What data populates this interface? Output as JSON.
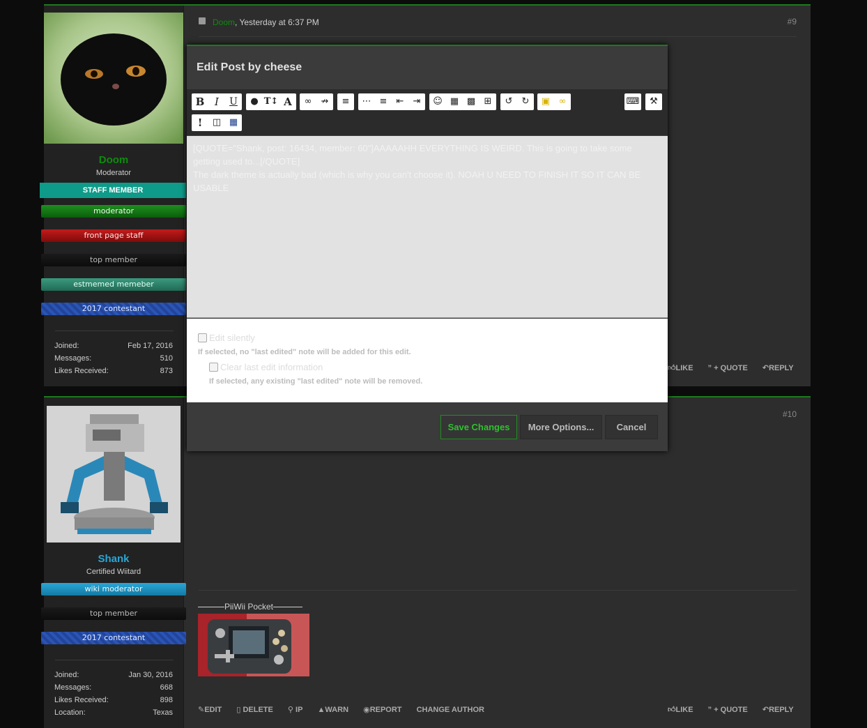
{
  "post1": {
    "number": "#9",
    "author": "Doom",
    "time": ", Yesterday at 6:37 PM",
    "username": "Doom",
    "user_title": "Moderator",
    "banners": [
      "STAFF MEMBER",
      "moderator",
      "front page staff",
      "top member",
      "estmemed memeber",
      "2017 contestant"
    ],
    "stats": [
      {
        "k": "Joined:",
        "v": "Feb 17, 2016"
      },
      {
        "k": "Messages:",
        "v": "510"
      },
      {
        "k": "Likes Received:",
        "v": "873"
      }
    ],
    "actions": [
      "LIKE",
      "+ QUOTE",
      "REPLY"
    ]
  },
  "post2": {
    "number": "#10",
    "username": "Shank",
    "user_title": "Certified Wiitard",
    "banners": [
      "wiki moderator",
      "top member",
      "2017 contestant"
    ],
    "stats": [
      {
        "k": "Joined:",
        "v": "Jan 30, 2016"
      },
      {
        "k": "Messages:",
        "v": "668"
      },
      {
        "k": "Likes Received:",
        "v": "898"
      },
      {
        "k": "Location:",
        "v": "Texas"
      }
    ],
    "signature_title": "PiiWii Pocket",
    "left_actions": [
      "EDIT",
      "DELETE",
      "IP",
      "WARN",
      "REPORT",
      "CHANGE AUTHOR"
    ],
    "right_actions": [
      "LIKE",
      "+ QUOTE",
      "REPLY"
    ]
  },
  "modal": {
    "title": "Edit Post by cheese",
    "editor_line1": "[QUOTE=\"Shank, post: 16434, member: 60\"]AAAAAHH EVERYTHING IS WEIRD. This is going to take some getting used to...[/QUOTE]",
    "editor_line2": "The dark theme is actually bad (which is why you can't choose it). NOAH U NEED TO FINISH IT SO IT CAN BE USABLE",
    "edit_silently_label": "Edit silently",
    "edit_silently_desc": "If selected, no \"last edited\" note will be added for this edit.",
    "clear_label": "Clear last edit information",
    "clear_desc": "If selected, any existing \"last edited\" note will be removed.",
    "save_label": "Save Changes",
    "more_label": "More Options...",
    "cancel_label": "Cancel"
  },
  "colors": {
    "accent_green": "#2fc12f",
    "staff_teal": "#0f9b8a",
    "shank_blue": "#2aa6d6"
  }
}
